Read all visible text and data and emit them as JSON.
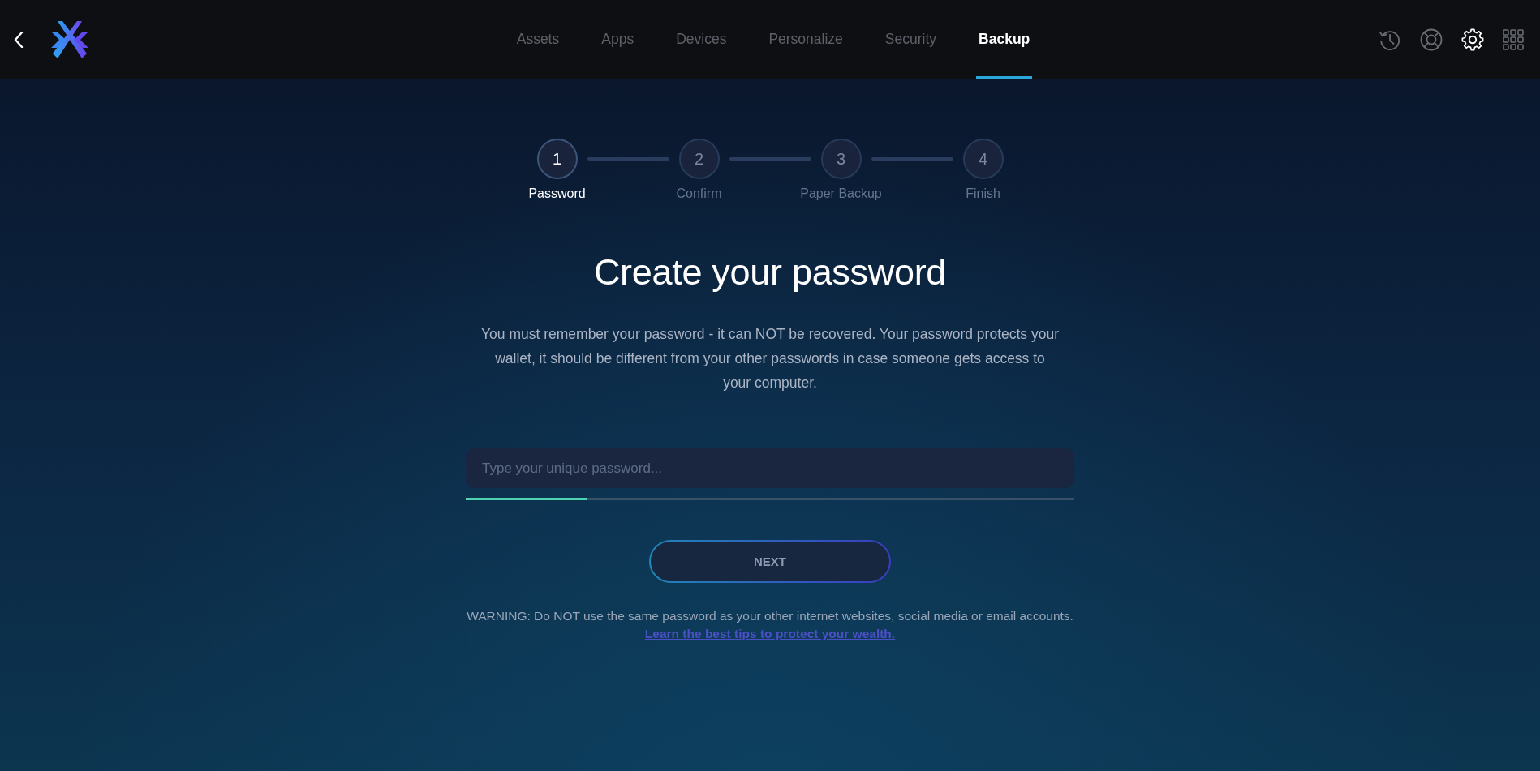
{
  "header": {
    "tabs": [
      {
        "label": "Assets",
        "selected": false
      },
      {
        "label": "Apps",
        "selected": false
      },
      {
        "label": "Devices",
        "selected": false
      },
      {
        "label": "Personalize",
        "selected": false
      },
      {
        "label": "Security",
        "selected": false
      },
      {
        "label": "Backup",
        "selected": true
      }
    ]
  },
  "stepper": {
    "steps": [
      {
        "number": "1",
        "label": "Password",
        "active": true
      },
      {
        "number": "2",
        "label": "Confirm",
        "active": false
      },
      {
        "number": "3",
        "label": "Paper Backup",
        "active": false
      },
      {
        "number": "4",
        "label": "Finish",
        "active": false
      }
    ]
  },
  "title": "Create your password",
  "description": "You must remember your password - it can NOT be recovered. Your password protects your wallet, it should be different from your other passwords in case someone gets access to your computer.",
  "password_field": {
    "placeholder": "Type your unique password..."
  },
  "strength_meter": {
    "level": 0.2
  },
  "next_button": {
    "label": "NEXT"
  },
  "warning": "WARNING: Do NOT use the same password as your other internet websites, social media or email accounts.",
  "link": "Learn the best tips to protect your wealth."
}
